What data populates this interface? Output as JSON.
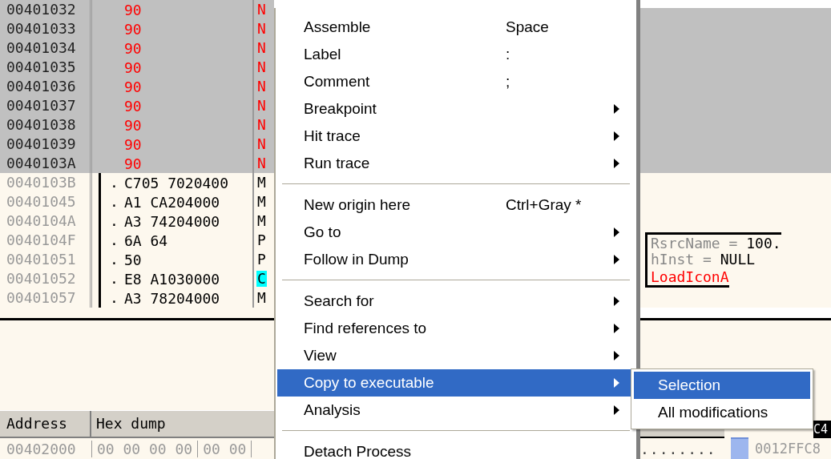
{
  "disassembly": {
    "rows": [
      {
        "address": "00401032",
        "hex": "90",
        "mnemonic": "N",
        "selected": true,
        "highlighted": false
      },
      {
        "address": "00401033",
        "hex": "90",
        "mnemonic": "N",
        "selected": true,
        "highlighted": false
      },
      {
        "address": "00401034",
        "hex": "90",
        "mnemonic": "N",
        "selected": true,
        "highlighted": false
      },
      {
        "address": "00401035",
        "hex": "90",
        "mnemonic": "N",
        "selected": true,
        "highlighted": false
      },
      {
        "address": "00401036",
        "hex": "90",
        "mnemonic": "N",
        "selected": true,
        "highlighted": false
      },
      {
        "address": "00401037",
        "hex": "90",
        "mnemonic": "N",
        "selected": true,
        "highlighted": false
      },
      {
        "address": "00401038",
        "hex": "90",
        "mnemonic": "N",
        "selected": true,
        "highlighted": false
      },
      {
        "address": "00401039",
        "hex": "90",
        "mnemonic": "N",
        "selected": true,
        "highlighted": false
      },
      {
        "address": "0040103A",
        "hex": "90",
        "mnemonic": "N",
        "selected": true,
        "highlighted": false
      },
      {
        "address": "0040103B",
        "marker": ".",
        "hex": "C705 7020400",
        "mnemonic": "M",
        "selected": false,
        "highlighted": false
      },
      {
        "address": "00401045",
        "marker": ".",
        "hex": "A1 CA204000",
        "mnemonic": "M",
        "selected": false,
        "highlighted": false
      },
      {
        "address": "0040104A",
        "marker": ".",
        "hex": "A3 74204000",
        "mnemonic": "M",
        "selected": false,
        "highlighted": false
      },
      {
        "address": "0040104F",
        "marker": ".",
        "hex": "6A 64",
        "mnemonic": "P",
        "selected": false,
        "highlighted": false,
        "comment": {
          "kind": "arg",
          "name": "RsrcName =",
          "value": "100."
        }
      },
      {
        "address": "00401051",
        "marker": ".",
        "hex": "50",
        "mnemonic": "P",
        "selected": false,
        "highlighted": false,
        "comment": {
          "kind": "arg",
          "name": "hInst =",
          "value": "NULL"
        }
      },
      {
        "address": "00401052",
        "marker": ".",
        "hex": "E8 A1030000",
        "mnemonic": "C",
        "selected": false,
        "highlighted": true,
        "comment": {
          "kind": "call",
          "name": "LoadIconA"
        }
      },
      {
        "address": "00401057",
        "marker": ".",
        "hex": "A3 78204000",
        "mnemonic": "M",
        "selected": false,
        "highlighted": false
      }
    ]
  },
  "dump": {
    "columns": [
      "Address",
      "Hex dump"
    ],
    "rows": [
      {
        "address": "00402000",
        "groups": [
          "00 00 00 00",
          "00 00"
        ],
        "ascii": "........"
      }
    ]
  },
  "stack": {
    "header": "C4",
    "rows": [
      {
        "address": "0012FFC8"
      }
    ]
  },
  "menu": {
    "items": [
      {
        "kind": "item",
        "label": "Assemble",
        "shortcut": "Space",
        "submenu": false,
        "selected": false
      },
      {
        "kind": "item",
        "label": "Label",
        "shortcut": ":",
        "submenu": false,
        "selected": false
      },
      {
        "kind": "item",
        "label": "Comment",
        "shortcut": ";",
        "submenu": false,
        "selected": false
      },
      {
        "kind": "item",
        "label": "Breakpoint",
        "submenu": true,
        "selected": false
      },
      {
        "kind": "item",
        "label": "Hit trace",
        "submenu": true,
        "selected": false
      },
      {
        "kind": "item",
        "label": "Run trace",
        "submenu": true,
        "selected": false
      },
      {
        "kind": "separator"
      },
      {
        "kind": "item",
        "label": "New origin here",
        "shortcut": "Ctrl+Gray *",
        "submenu": false,
        "selected": false
      },
      {
        "kind": "item",
        "label": "Go to",
        "submenu": true,
        "selected": false
      },
      {
        "kind": "item",
        "label": "Follow in Dump",
        "submenu": true,
        "selected": false
      },
      {
        "kind": "separator"
      },
      {
        "kind": "item",
        "label": "Search for",
        "submenu": true,
        "selected": false
      },
      {
        "kind": "item",
        "label": "Find references to",
        "submenu": true,
        "selected": false
      },
      {
        "kind": "item",
        "label": "View",
        "submenu": true,
        "selected": false
      },
      {
        "kind": "item",
        "label": "Copy to executable",
        "submenu": true,
        "selected": true
      },
      {
        "kind": "item",
        "label": "Analysis",
        "submenu": true,
        "selected": false
      },
      {
        "kind": "separator"
      },
      {
        "kind": "item",
        "label": "Detach Process",
        "submenu": false,
        "selected": false
      }
    ]
  },
  "submenu": {
    "items": [
      {
        "label": "Selection",
        "selected": true
      },
      {
        "label": "All modifications",
        "selected": false
      }
    ]
  }
}
